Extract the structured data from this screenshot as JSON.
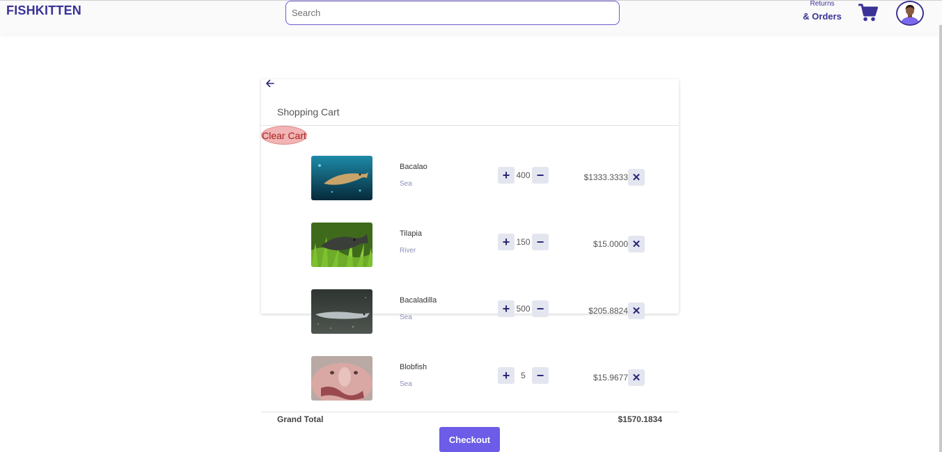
{
  "header": {
    "brand": "FISHKITTEN",
    "search_placeholder": "Search",
    "returns_line1": "Returns",
    "returns_line2": "& Orders",
    "cart_icon": "shopping-cart-icon",
    "avatar_icon": "user-avatar-icon"
  },
  "cart": {
    "back_icon": "arrow-left-icon",
    "title": "Shopping Cart",
    "clear_label": "Clear Cart",
    "items": [
      {
        "name": "Bacalao",
        "type": "Sea",
        "quantity": "400",
        "price": "$1333.3333",
        "image": "cod-underwater-photo"
      },
      {
        "name": "Tilapia",
        "type": "River",
        "quantity": "150",
        "price": "$15.0000",
        "image": "tilapia-in-seagrass-photo"
      },
      {
        "name": "Bacaladilla",
        "type": "Sea",
        "quantity": "500",
        "price": "$205.8824",
        "image": "blue-whiting-photo"
      },
      {
        "name": "Blobfish",
        "type": "Sea",
        "quantity": "5",
        "price": "$15.9677",
        "image": "blobfish-photo"
      }
    ],
    "plus_symbol": "+",
    "minus_symbol": "−",
    "remove_symbol": "✕",
    "grand_total_label": "Grand Total",
    "grand_total_value": "$1570.1834",
    "checkout_label": "Checkout"
  },
  "colors": {
    "brand": "#3a3296",
    "accent": "#6c5ce7",
    "clear_bg": "#f2b4b4",
    "button_bg": "#e4e6ef"
  }
}
